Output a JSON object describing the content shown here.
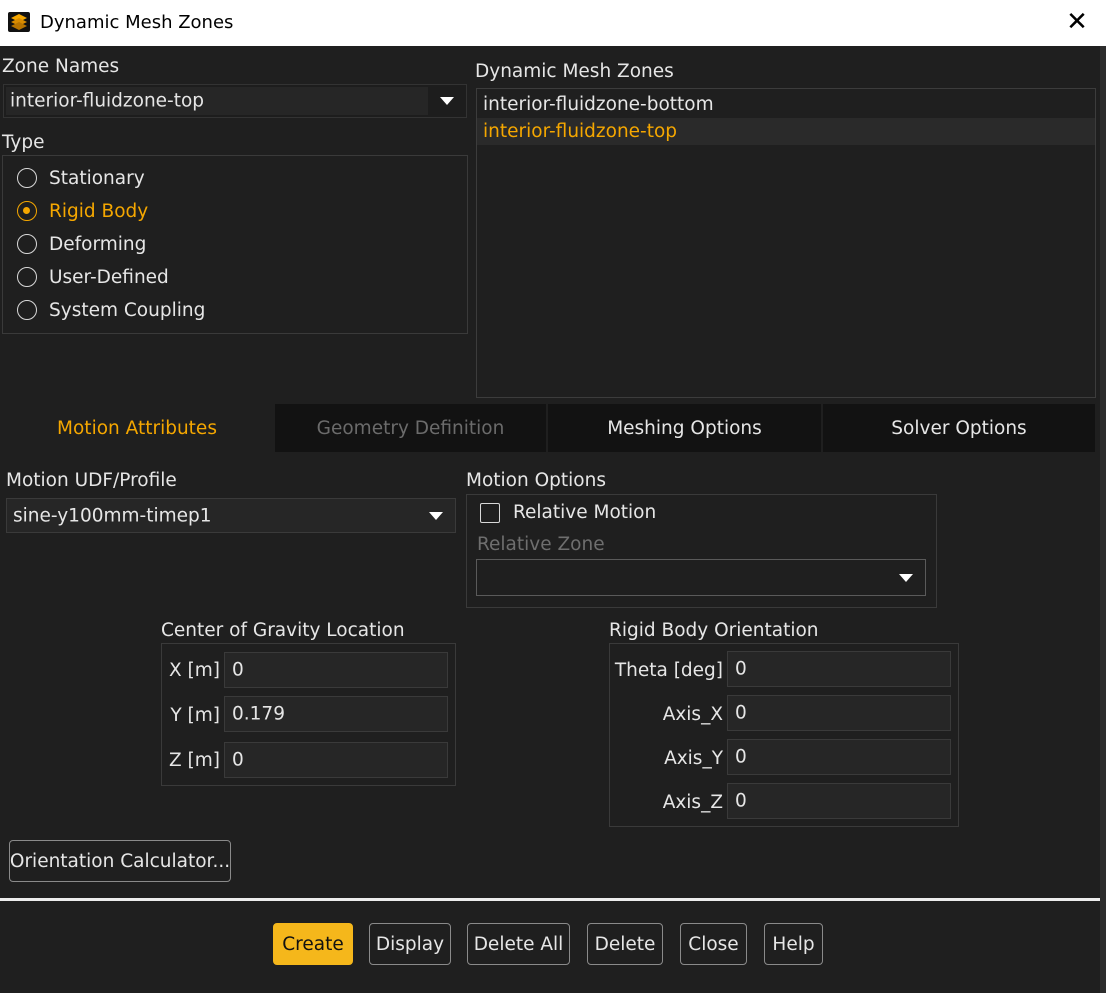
{
  "window": {
    "title": "Dynamic Mesh Zones",
    "icon": "fluent-app-icon",
    "close_icon": "close-icon",
    "close_glyph": "✕"
  },
  "zone_names": {
    "label": "Zone Names",
    "selected": "interior-fluidzone-top"
  },
  "type": {
    "label": "Type",
    "options": [
      {
        "label": "Stationary",
        "checked": false
      },
      {
        "label": "Rigid Body",
        "checked": true
      },
      {
        "label": "Deforming",
        "checked": false
      },
      {
        "label": "User-Defined",
        "checked": false
      },
      {
        "label": "System Coupling",
        "checked": false
      }
    ]
  },
  "dynamic_mesh_zones": {
    "label": "Dynamic Mesh Zones",
    "items": [
      {
        "label": "interior-fluidzone-bottom",
        "selected": false
      },
      {
        "label": "interior-fluidzone-top",
        "selected": true
      }
    ]
  },
  "tabs": [
    {
      "label": "Motion Attributes",
      "state": "active"
    },
    {
      "label": "Geometry Definition",
      "state": "disabled"
    },
    {
      "label": "Meshing Options",
      "state": "normal"
    },
    {
      "label": "Solver Options",
      "state": "normal"
    }
  ],
  "motion": {
    "udf_label": "Motion UDF/Profile",
    "udf_value": "sine-y100mm-timep1",
    "options_label": "Motion Options",
    "relative_motion_label": "Relative Motion",
    "relative_motion_checked": false,
    "relative_zone_label": "Relative Zone",
    "relative_zone_value": ""
  },
  "center_of_gravity": {
    "label": "Center of Gravity Location",
    "fields": [
      {
        "label": "X [m]",
        "value": "0"
      },
      {
        "label": "Y [m]",
        "value": "0.179"
      },
      {
        "label": "Z [m]",
        "value": "0"
      }
    ]
  },
  "orientation": {
    "label": "Rigid Body Orientation",
    "fields": [
      {
        "label": "Theta [deg]",
        "value": "0"
      },
      {
        "label": "Axis_X",
        "value": "0"
      },
      {
        "label": "Axis_Y",
        "value": "0"
      },
      {
        "label": "Axis_Z",
        "value": "0"
      }
    ]
  },
  "orientation_calculator_label": "Orientation Calculator...",
  "footer_buttons": [
    {
      "label": "Create",
      "primary": true
    },
    {
      "label": "Display",
      "primary": false
    },
    {
      "label": "Delete All",
      "primary": false
    },
    {
      "label": "Delete",
      "primary": false
    },
    {
      "label": "Close",
      "primary": false
    },
    {
      "label": "Help",
      "primary": false
    }
  ],
  "colors": {
    "accent": "#f5a700",
    "background": "#1f1f1f",
    "primary_button": "#f5b71b"
  }
}
